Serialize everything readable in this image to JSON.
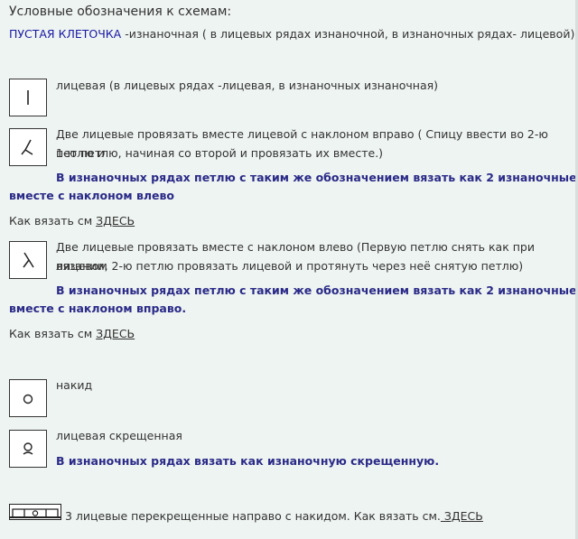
{
  "title": "Условные обозначения к схемам:",
  "empty_cell": {
    "label": "ПУСТАЯ КЛЕТОЧКА",
    "text": " -изнаночная ( в лицевых рядах изнаночной, в изнаночных рядах- лицевой)"
  },
  "items": [
    {
      "symbol": "|",
      "icon": "vertical-bar-icon",
      "text": "лицевая (в лицевых рядах -лицевая, в изнаночных изнаночная)"
    },
    {
      "symbol": "⅄",
      "icon": "right-lean-decrease-icon",
      "line1": "Две лицевые провязать вместе лицевой с наклоном вправо ( Спицу ввести во  2-ю петлю и",
      "line2": "1-ю петлю, начиная со второй и провязать их вместе.)",
      "note1": "В изнаночных рядах петлю с таким же обозначением  вязать  как 2 изнаночные",
      "note2": "вместе с наклоном влево",
      "howto_prefix": "Как вязать см ",
      "howto_link": "ЗДЕСЬ"
    },
    {
      "symbol": "λ",
      "icon": "left-lean-decrease-icon",
      "line1": "Две  лицевые  провязать вместе с наклоном влево (Первую петлю снять как при лицевом",
      "line2": "вязании, 2-ю петлю провязать лицевой и протянуть через неё снятую петлю)",
      "note1": "В изнаночных рядах петлю с таким же обозначением  вязать  как 2 изнаночные",
      "note2": "вместе с наклоном вправо.",
      "howto_prefix": "Как вязать см ",
      "howto_link": "ЗДЕСЬ"
    },
    {
      "symbol": "o",
      "icon": "yarn-over-icon",
      "text": "накид"
    },
    {
      "symbol": "ọ",
      "icon": "twisted-knit-icon",
      "text": "лицевая скрещенная",
      "note1": "В изнаночных рядах вязать как  изнаночную скрещенную."
    },
    {
      "icon": "cable-three-knit-icon",
      "text": "3 лицевые перекрещенные направо с накидом. Как вязать см.",
      "howto_link": " ЗДЕСЬ"
    }
  ]
}
